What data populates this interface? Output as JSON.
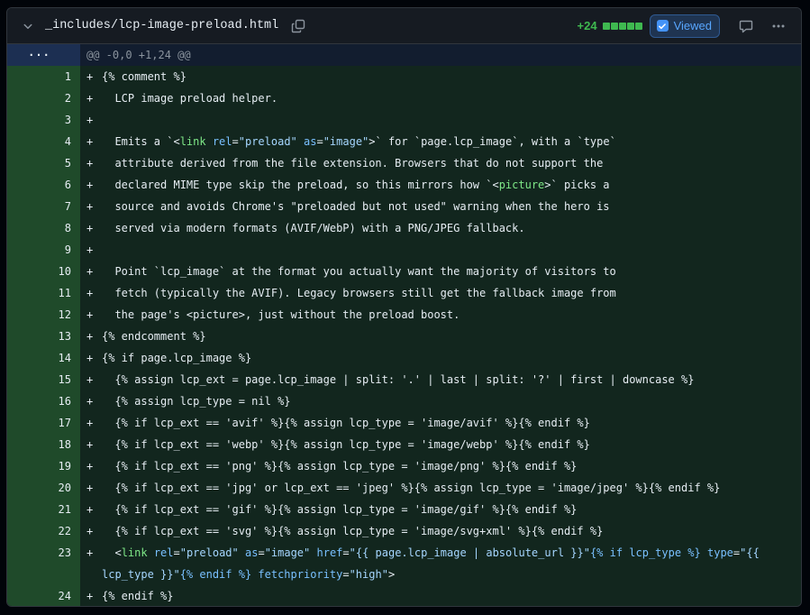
{
  "file": {
    "path": "_includes/lcp-image-preload.html",
    "additions": "+24",
    "viewed_label": "Viewed",
    "colors": {
      "addition": "#3fb950",
      "accent": "#4493f8"
    }
  },
  "hunk": {
    "expand_label": "···",
    "header": "@@ -0,0 +1,24 @@"
  },
  "lines": [
    {
      "num": "1",
      "text": "{% comment %}"
    },
    {
      "num": "2",
      "text": "  LCP image preload helper."
    },
    {
      "num": "3",
      "text": ""
    },
    {
      "num": "4",
      "pre": "  Emits a `<",
      "tag": "link",
      "a1": " rel",
      "e1": "=",
      "v1": "\"preload\"",
      "a2": " as",
      "e2": "=",
      "v2": "\"image\"",
      "post": ">` for `page.lcp_image`, with a `type`"
    },
    {
      "num": "5",
      "text": "  attribute derived from the file extension. Browsers that do not support the"
    },
    {
      "num": "6",
      "pre": "  declared MIME type skip the preload, so this mirrors how `<",
      "tag": "picture",
      "post": ">` picks a"
    },
    {
      "num": "7",
      "text": "  source and avoids Chrome's \"preloaded but not used\" warning when the hero is"
    },
    {
      "num": "8",
      "text": "  served via modern formats (AVIF/WebP) with a PNG/JPEG fallback."
    },
    {
      "num": "9",
      "text": ""
    },
    {
      "num": "10",
      "text": "  Point `lcp_image` at the format you actually want the majority of visitors to"
    },
    {
      "num": "11",
      "text": "  fetch (typically the AVIF). Legacy browsers still get the fallback image from"
    },
    {
      "num": "12",
      "text": "  the page's <picture>, just without the preload boost."
    },
    {
      "num": "13",
      "text": "{% endcomment %}"
    },
    {
      "num": "14",
      "text": "{% if page.lcp_image %}"
    },
    {
      "num": "15",
      "text": "  {% assign lcp_ext = page.lcp_image | split: '.' | last | split: '?' | first | downcase %}"
    },
    {
      "num": "16",
      "text": "  {% assign lcp_type = nil %}"
    },
    {
      "num": "17",
      "text": "  {% if lcp_ext == 'avif' %}{% assign lcp_type = 'image/avif' %}{% endif %}"
    },
    {
      "num": "18",
      "text": "  {% if lcp_ext == 'webp' %}{% assign lcp_type = 'image/webp' %}{% endif %}"
    },
    {
      "num": "19",
      "text": "  {% if lcp_ext == 'png' %}{% assign lcp_type = 'image/png' %}{% endif %}"
    },
    {
      "num": "20",
      "text": "  {% if lcp_ext == 'jpg' or lcp_ext == 'jpeg' %}{% assign lcp_type = 'image/jpeg' %}{% endif %}"
    },
    {
      "num": "21",
      "text": "  {% if lcp_ext == 'gif' %}{% assign lcp_type = 'image/gif' %}{% endif %}"
    },
    {
      "num": "22",
      "text": "  {% if lcp_ext == 'svg' %}{% assign lcp_type = 'image/svg+xml' %}{% endif %}"
    },
    {
      "num": "23",
      "l23": {
        "indent": "  <",
        "tag": "link",
        "a1": " rel",
        "eq": "=",
        "v1": "\"preload\"",
        "a2": " as",
        "v2": "\"image\"",
        "a3": " href",
        "v3a": "\"{{ page.lcp_image | absolute_url }}\"",
        "liq1": "{% if lcp_type %}",
        "a4": " type",
        "v4a": "\"{{",
        "v4b": "lcp_type }}\"",
        "liq2": "{% endif %}",
        "a5": " fetchpriority",
        "v5": "\"high\"",
        "close": ">"
      }
    },
    {
      "num": "24",
      "text": "{% endif %}"
    }
  ]
}
